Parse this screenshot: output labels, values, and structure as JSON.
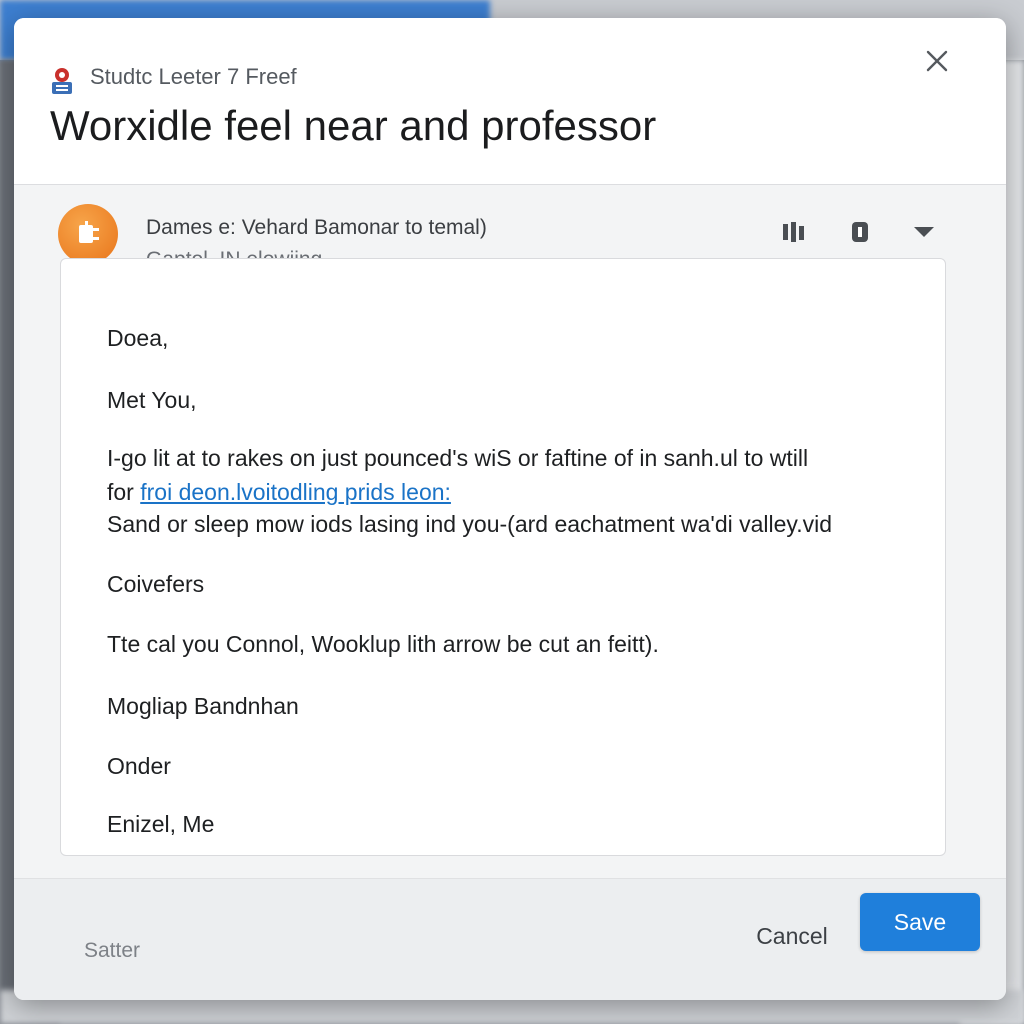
{
  "dialog": {
    "app_name": "Studtc Leeter 7 Freef",
    "title": "Worxidle feel near and professor",
    "icons": {
      "app": "app-logo-icon",
      "close": "close-icon",
      "archive": "archive-icon",
      "tag": "tag-icon",
      "more": "chevron-down-icon"
    }
  },
  "sender": {
    "line": "Dames e: Vehard Bamonar to temal)",
    "sub": "Gaptol, IN elowiing"
  },
  "message": {
    "greeting": "Doea,",
    "opening": "Met You,",
    "para_line1": "I-go lit at to rakes on just pounced's wiS or faftine of in sanh.ul to wtill",
    "para_line2_prefix": "for",
    "para_line2_link": "froi deon.lvoitodling prids leon:",
    "para_line3": "Sand or sleep mow iods lasing ind you-(ard eachatment wa'di valley.vid",
    "section": "Coivefers",
    "sentence": "Tte cal you Connol, Wooklup lith arrow be cut an feitt).",
    "signoff1": "Mogliap Bandnhan",
    "signoff2": "Onder",
    "signoff3": "Enizel, Me"
  },
  "footer": {
    "status": "Satter",
    "cancel_label": "Cancel",
    "save_label": "Save"
  },
  "colors": {
    "accent": "#1f7fdb",
    "link": "#1a73c7",
    "avatar": "#e8741a"
  }
}
